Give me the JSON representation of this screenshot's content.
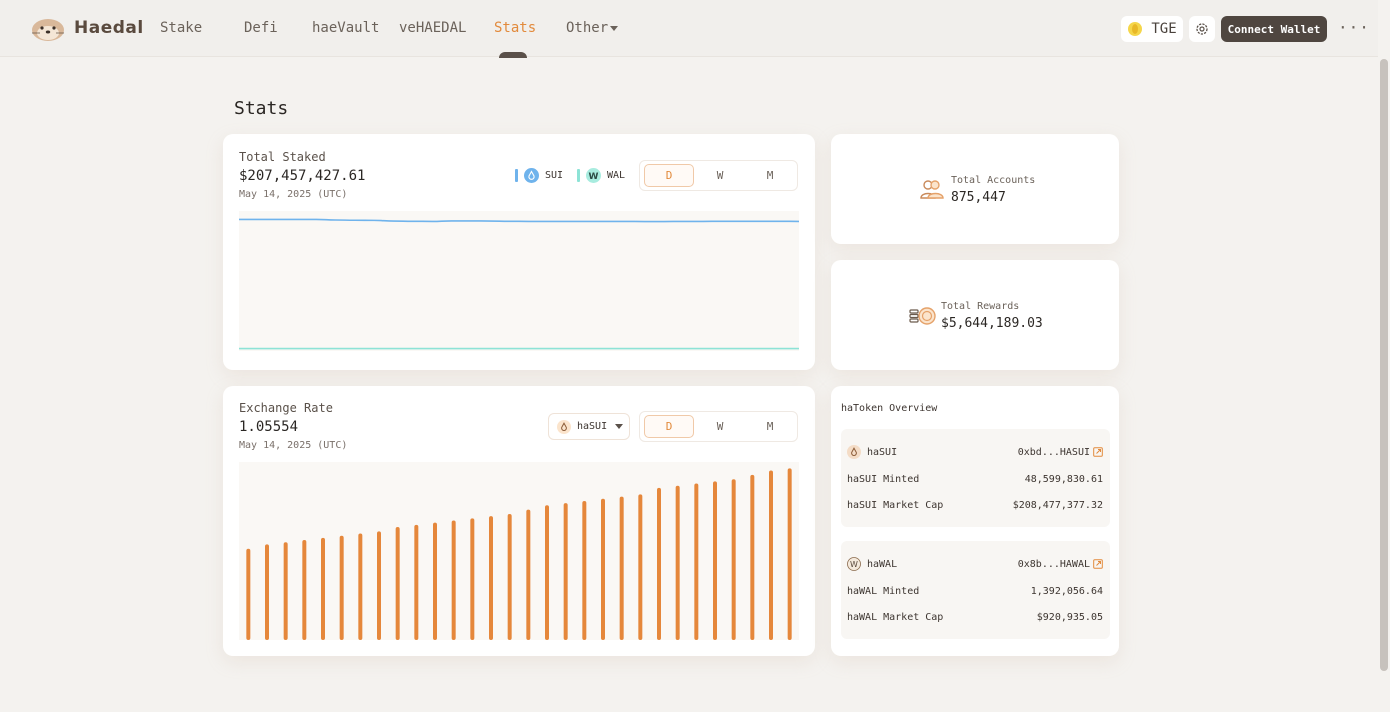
{
  "nav": {
    "brand": "Haedal",
    "items": [
      {
        "label": "Stake"
      },
      {
        "label": "Defi"
      },
      {
        "label": "haeVault"
      },
      {
        "label": "veHAEDAL"
      },
      {
        "label": "Stats",
        "active": true
      },
      {
        "label": "Other",
        "dropdown": true
      }
    ],
    "tge_label": "TGE",
    "connect_label": "Connect Wallet",
    "more_label": "···"
  },
  "page": {
    "title": "Stats"
  },
  "total_staked": {
    "label": "Total Staked",
    "value": "$207,457,427.61",
    "date": "May 14, 2025 (UTC)",
    "legend": [
      {
        "name": "SUI",
        "color": "#6fb3ec"
      },
      {
        "name": "WAL",
        "color": "#8de3d6"
      }
    ],
    "ranges": [
      "D",
      "W",
      "M"
    ],
    "active_range": "D"
  },
  "exchange_rate": {
    "label": "Exchange Rate",
    "value": "1.05554",
    "date": "May 14, 2025 (UTC)",
    "token": "haSUI",
    "ranges": [
      "D",
      "W",
      "M"
    ],
    "active_range": "D"
  },
  "accounts": {
    "label": "Total Accounts",
    "value": "875,447"
  },
  "rewards": {
    "label": "Total Rewards",
    "value": "$5,644,189.03"
  },
  "overview": {
    "title": "haToken Overview",
    "tokens": [
      {
        "name": "haSUI",
        "address": "0xbd...HASUI",
        "minted_label": "haSUI Minted",
        "minted": "48,599,830.61",
        "cap_label": "haSUI Market Cap",
        "cap": "$208,477,377.32"
      },
      {
        "name": "haWAL",
        "address": "0x8b...HAWAL",
        "minted_label": "haWAL Minted",
        "minted": "1,392,056.64",
        "cap_label": "haWAL Market Cap",
        "cap": "$920,935.05"
      }
    ]
  },
  "colors": {
    "accent": "#e28a3c",
    "sui_line": "#6fb3ec",
    "wal_line": "#8de3d6",
    "bar": "#e5873b"
  },
  "chart_data": [
    {
      "type": "line",
      "title": "Total Staked",
      "series": [
        {
          "name": "SUI",
          "values": [
            100,
            100,
            100,
            100,
            100,
            99.6,
            99.4,
            99.3,
            98.8,
            98.6,
            98.5,
            98.9,
            98.9,
            98.8,
            98.6,
            98.5,
            98.5,
            98.5,
            98.5,
            98.5,
            98.5,
            98.4,
            98.4,
            98.5,
            98.5,
            98.6,
            98.6,
            98.6,
            98.6,
            98.5
          ]
        },
        {
          "name": "WAL",
          "values": [
            0.3,
            0.3,
            0.3,
            0.3,
            0.3,
            0.3,
            0.3,
            0.3,
            0.3,
            0.3,
            0.3,
            0.3,
            0.3,
            0.3,
            0.3,
            0.3,
            0.3,
            0.3,
            0.3,
            0.3,
            0.3,
            0.3,
            0.3,
            0.3,
            0.3,
            0.3,
            0.3,
            0.3,
            0.3,
            0.3
          ]
        }
      ],
      "ylim": [
        0,
        105
      ]
    },
    {
      "type": "bar",
      "title": "Exchange Rate",
      "values": [
        1.0506,
        1.0508,
        1.0509,
        1.051,
        1.0511,
        1.0512,
        1.0513,
        1.0514,
        1.0516,
        1.0517,
        1.0518,
        1.0519,
        1.052,
        1.0521,
        1.0522,
        1.0524,
        1.0526,
        1.0527,
        1.0528,
        1.0529,
        1.053,
        1.0531,
        1.0534,
        1.0535,
        1.0536,
        1.0537,
        1.0538,
        1.054,
        1.0542,
        1.0543
      ],
      "ylim": [
        1.0464,
        1.0545
      ]
    }
  ]
}
